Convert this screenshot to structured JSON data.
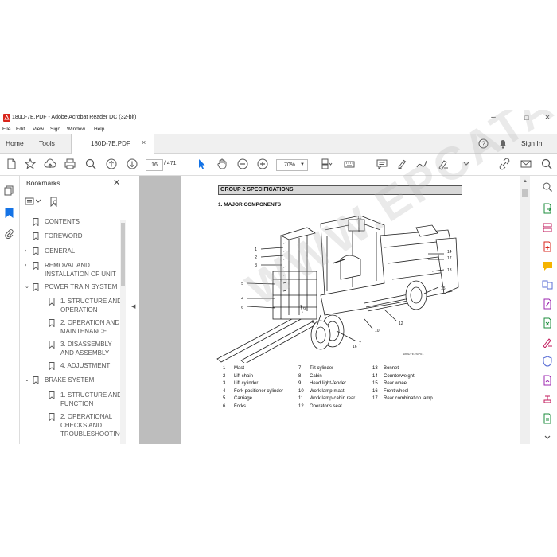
{
  "window": {
    "title": "180D-7E.PDF - Adobe Acrobat Reader DC (32-bit)",
    "controls": {
      "minimize": "–",
      "maximize": "□",
      "close": "✕"
    }
  },
  "menu": [
    "File",
    "Edit",
    "View",
    "Sign",
    "Window",
    "Help"
  ],
  "tabs": {
    "home": "Home",
    "tools": "Tools",
    "document": "180D-7E.PDF",
    "close": "×",
    "help": "?",
    "signin": "Sign In"
  },
  "toolbar": {
    "page_current": "16",
    "page_total": "/ 471",
    "zoom": "70%",
    "zoom_caret": "▼"
  },
  "bookmarks": {
    "title": "Bookmarks",
    "close": "✕",
    "items": [
      {
        "label": "CONTENTS",
        "level": 0,
        "expander": ""
      },
      {
        "label": "FOREWORD",
        "level": 0,
        "expander": ""
      },
      {
        "label": "GENERAL",
        "level": 0,
        "expander": "›"
      },
      {
        "label": "REMOVAL AND",
        "label2": "INSTALLATION OF UNIT",
        "level": 0,
        "expander": "›"
      },
      {
        "label": "POWER TRAIN SYSTEM",
        "level": 0,
        "expander": "⌄"
      },
      {
        "label": "1. STRUCTURE AND",
        "label2": "OPERATION",
        "level": 1,
        "expander": ""
      },
      {
        "label": "2. OPERATION AND",
        "label2": "MAINTENANCE",
        "level": 1,
        "expander": ""
      },
      {
        "label": "3. DISASSEMBLY",
        "label2": "AND ASSEMBLY",
        "level": 1,
        "expander": ""
      },
      {
        "label": "4. ADJUSTMENT",
        "level": 1,
        "expander": ""
      },
      {
        "label": "BRAKE SYSTEM",
        "level": 0,
        "expander": "⌄"
      },
      {
        "label": "1. STRUCTURE AND",
        "label2": "FUNCTION",
        "level": 1,
        "expander": ""
      },
      {
        "label": "2. OPERATIONAL",
        "label2": "CHECKS AND",
        "label3": "TROUBLESHOOTING",
        "level": 1,
        "expander": ""
      }
    ]
  },
  "document": {
    "group_title": "GROUP 2  SPECIFICATIONS",
    "section_title": "1. MAJOR COMPONENTS",
    "figure_id": "180D7E2SP01",
    "watermark": "WWW.EPCATALOGS.COM",
    "callouts": [
      "1",
      "2",
      "3",
      "5",
      "4",
      "6",
      "11",
      "14",
      "17",
      "13",
      "15",
      "12",
      "10",
      "7",
      "16",
      "8",
      "9"
    ],
    "legend": [
      {
        "n": "1",
        "t": "Mast"
      },
      {
        "n": "2",
        "t": "Lift chain"
      },
      {
        "n": "3",
        "t": "Lift cylinder"
      },
      {
        "n": "4",
        "t": "Fork positioner cylinder"
      },
      {
        "n": "5",
        "t": "Carriage"
      },
      {
        "n": "6",
        "t": "Forks"
      },
      {
        "n": "7",
        "t": "Tilt cylinder"
      },
      {
        "n": "8",
        "t": "Cabin"
      },
      {
        "n": "9",
        "t": "Head light-fender"
      },
      {
        "n": "10",
        "t": "Work lamp-mast"
      },
      {
        "n": "11",
        "t": "Work lamp-cabin rear"
      },
      {
        "n": "12",
        "t": "Operator's seat"
      },
      {
        "n": "13",
        "t": "Bonnet"
      },
      {
        "n": "14",
        "t": "Counterweight"
      },
      {
        "n": "15",
        "t": "Rear wheel"
      },
      {
        "n": "16",
        "t": "Front wheel"
      },
      {
        "n": "17",
        "t": "Rear combination lamp"
      }
    ]
  },
  "colors": {
    "accent": "#1473e6",
    "pdf_red": "#d9261c",
    "doc_bg": "#bdbdbd"
  }
}
